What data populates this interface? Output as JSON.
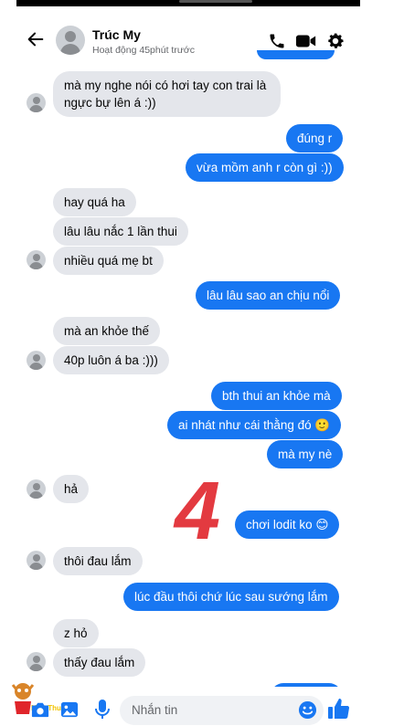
{
  "header": {
    "name": "Trúc My",
    "status": "Hoạt động 45phút trước"
  },
  "messages": [
    {
      "side": "in",
      "text": "mà my nghe nói có hơi tay con trai là ngực bự lên á :))"
    },
    {
      "side": "out",
      "text": "đúng r"
    },
    {
      "side": "out",
      "text": "vừa mồm anh r còn gì :))"
    },
    {
      "side": "in",
      "text": "hay quá ha"
    },
    {
      "side": "in",
      "text": "lâu lâu nắc 1 lần thui"
    },
    {
      "side": "in",
      "text": "nhiều quá mẹ bt"
    },
    {
      "side": "out",
      "text": "lâu lâu sao an chịu nổi"
    },
    {
      "side": "in",
      "text": "mà an khỏe thế"
    },
    {
      "side": "in",
      "text": "40p luôn á ba :)))"
    },
    {
      "side": "out",
      "text": "bth thui an khỏe mà"
    },
    {
      "side": "out",
      "text": "ai nhát như cái thằng đó 🙂"
    },
    {
      "side": "out",
      "text": "mà my nè"
    },
    {
      "side": "in",
      "text": "hả"
    },
    {
      "side": "out",
      "text": "chơi lodit ko 😊"
    },
    {
      "side": "in",
      "text": "thôi đau lắm"
    },
    {
      "side": "out",
      "text": "lúc đầu thôi chứ lúc sau sướng lắm"
    },
    {
      "side": "in",
      "text": "z hỏ"
    },
    {
      "side": "in",
      "text": "thấy đau lắm"
    }
  ],
  "watermark": {
    "number": "4"
  },
  "composer": {
    "placeholder": "Nhắn tin",
    "mascot_label": "Meo Thuật"
  },
  "colors": {
    "accent": "#1877f2",
    "incoming_bubble": "#e4e6eb",
    "watermark": "#e0252b"
  },
  "icons": [
    "back-arrow-icon",
    "phone-icon",
    "video-camera-icon",
    "gear-icon",
    "camera-icon",
    "image-icon",
    "microphone-icon",
    "emoji-icon",
    "thumbs-up-icon"
  ]
}
